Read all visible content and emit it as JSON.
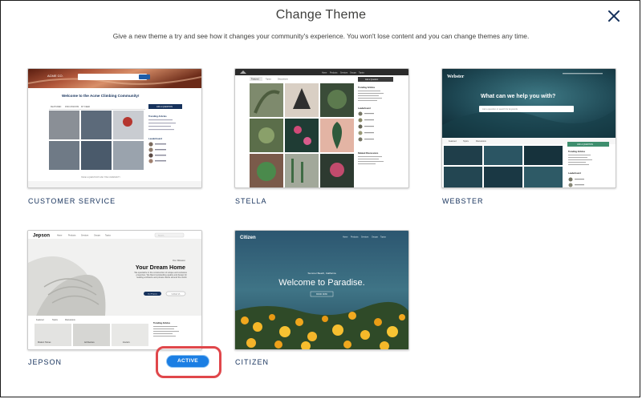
{
  "modal": {
    "title": "Change Theme",
    "subtitle": "Give a new theme a try and see how it changes your community's experience. You won't lose content and you can change themes any time.",
    "close_icon": "close-icon"
  },
  "themes": [
    {
      "name": "CUSTOMER SERVICE",
      "preview": {
        "brand": "ACME CO.",
        "hero_title": "Welcome to the Acme Climbing Community!",
        "cta": "ASK A QUESTION",
        "trending_label": "Trending Articles",
        "leaderboard_label": "Leaderboard",
        "tabs": [
          "FEATURED",
          "DISCUSSIONS",
          "MY FEED"
        ],
        "footer_link": "HAVE A QUESTION? ASK THE COMMUNITY"
      }
    },
    {
      "name": "STELLA",
      "preview": {
        "nav": [
          "Home",
          "Products",
          "Services",
          "Groups",
          "Topics"
        ],
        "tabs": [
          "Featured",
          "Topics",
          "Discussions"
        ],
        "cta": "Ask a Question",
        "trending_label": "Trending Articles",
        "leaderboard_label": "Leaderboard",
        "related_label": "Related Discussions"
      }
    },
    {
      "name": "WEBSTER",
      "preview": {
        "brand": "Webster",
        "hero_title": "What can we help you with?",
        "search_placeholder": "Ask a question or search for keywords",
        "tabs": [
          "Featured",
          "Topics",
          "Discussions"
        ],
        "cta": "ASK A QUESTION",
        "trending_label": "Trending Articles",
        "leaderboard_label": "Leaderboard"
      }
    },
    {
      "name": "JEPSON",
      "preview": {
        "brand": "Jepson",
        "nav": [
          "Home",
          "Products",
          "Services",
          "Groups",
          "Topics"
        ],
        "search_placeholder": "Search...",
        "mission_label": "Our Mission",
        "hero_title": "Your Dream Home",
        "hero_text": "We specialize in the construction of unique and exclusive properties. We blend outstanding quality and design for leading architects and private clients around the world.",
        "cta_primary": "Our Projects",
        "cta_secondary": "Contact Us",
        "tabs": [
          "Featured",
          "Topics",
          "Discussions"
        ],
        "tiles": [
          "Modern Homes",
          "Architecture",
          "Interiors"
        ],
        "trending_label": "Trending Articles"
      }
    },
    {
      "name": "CITIZEN",
      "preview": {
        "brand": "Citizen",
        "nav": [
          "Home",
          "Products",
          "Services",
          "Groups",
          "Topics"
        ],
        "location": "Summer Beach, California",
        "hero_title": "Welcome to Paradise.",
        "cta": "BOOK NOW"
      }
    }
  ],
  "active_badge": "ACTIVE",
  "colors": {
    "accent": "#1b7ee3",
    "highlight": "#e0474b",
    "theme_label": "#16325c"
  }
}
